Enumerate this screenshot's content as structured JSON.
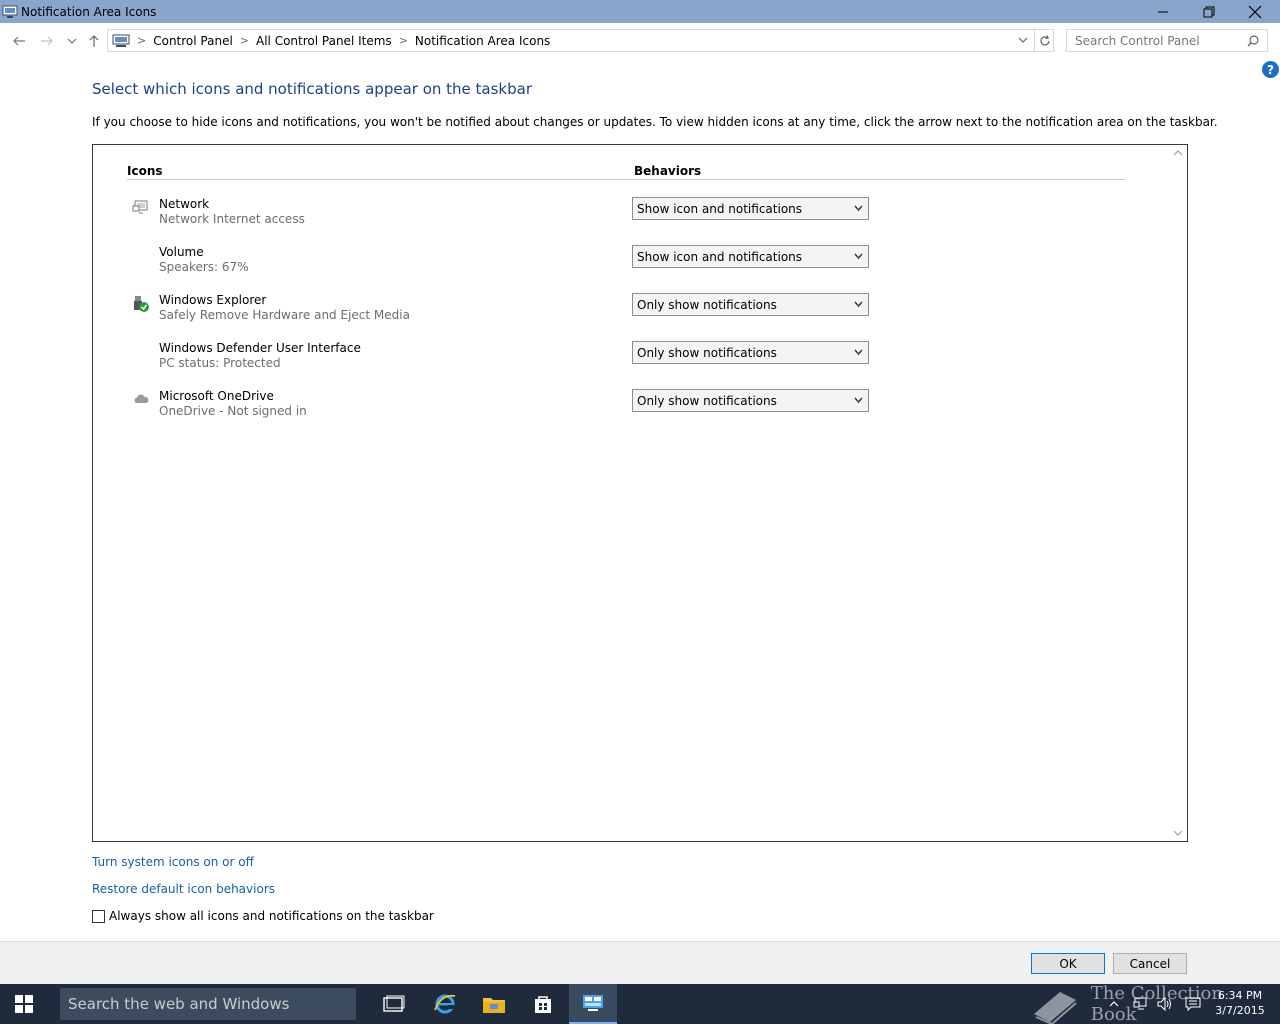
{
  "window": {
    "title": "Notification Area Icons",
    "controls": [
      "minimize",
      "maximize",
      "close"
    ]
  },
  "address": {
    "crumbs": [
      "Control Panel",
      "All Control Panel Items",
      "Notification Area Icons"
    ],
    "search_placeholder": "Search Control Panel"
  },
  "page": {
    "heading": "Select which icons and notifications appear on the taskbar",
    "description": "If you choose to hide icons and notifications, you won't be notified about changes or updates. To view hidden icons at any time, click the arrow next to the notification area on the taskbar.",
    "col_icons": "Icons",
    "col_behaviors": "Behaviors"
  },
  "rows": [
    {
      "name": "Network",
      "sub": "Network Internet access",
      "behavior": "Show icon and notifications",
      "icon": "network-icon"
    },
    {
      "name": "Volume",
      "sub": "Speakers: 67%",
      "behavior": "Show icon and notifications",
      "icon": ""
    },
    {
      "name": "Windows Explorer",
      "sub": "Safely Remove Hardware and Eject Media",
      "behavior": "Only show notifications",
      "icon": "usb-eject-icon"
    },
    {
      "name": "Windows Defender User Interface",
      "sub": "PC status: Protected",
      "behavior": "Only show notifications",
      "icon": ""
    },
    {
      "name": "Microsoft OneDrive",
      "sub": "OneDrive - Not signed in",
      "behavior": "Only show notifications",
      "icon": "onedrive-cloud-icon"
    }
  ],
  "links": {
    "system_icons": "Turn system icons on or off",
    "restore": "Restore default icon behaviors"
  },
  "checkbox": {
    "label": "Always show all icons and notifications on the taskbar",
    "checked": false
  },
  "buttons": {
    "ok": "OK",
    "cancel": "Cancel"
  },
  "taskbar": {
    "search_placeholder": "Search the web and Windows",
    "time": "6:34 PM",
    "date": "3/7/2015",
    "watermark": "The Collection Book"
  },
  "colors": {
    "titlebar": "#8aa5cc",
    "heading": "#1e3f8a",
    "link": "#1760a8",
    "taskbar": "#1f2a3c"
  }
}
